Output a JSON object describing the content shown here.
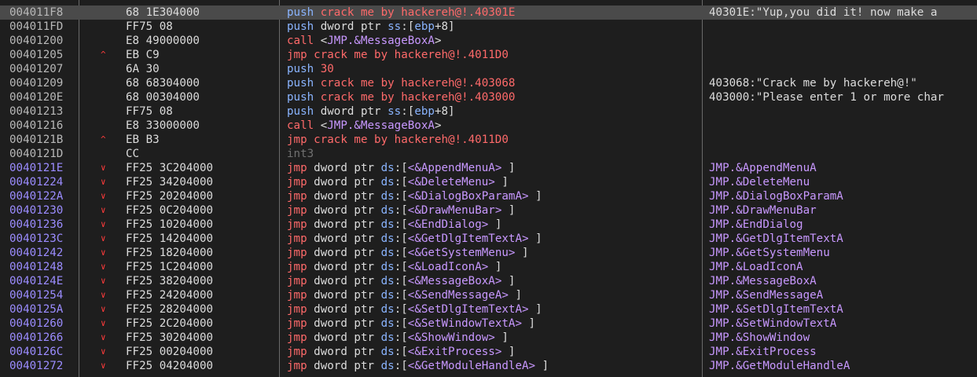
{
  "colors": {
    "background": "#1e1e1e",
    "selected_row": "#4a4a4a",
    "addr_plain": "#b8b8b8",
    "addr_highlight": "#9b8cff",
    "bytes": "#dcdcdc",
    "mnemonic_red": "#ff6a6a",
    "mnemonic_push": "#8ab4ff",
    "mnemonic_call": "#ff6a6a",
    "mnemonic_jmp": "#ff6a6a",
    "operand": "#dcdcdc",
    "register": "#8ab4ff",
    "symbol": "#c898ff",
    "int3": "#707070",
    "arrow_red": "#ff3b3b",
    "comment_str": "#dcdcdc",
    "comment_sym": "#c898ff"
  },
  "rows": [
    {
      "addr": "004011F8",
      "arrow": "",
      "bytes": "68 1E304000",
      "mn": "push",
      "ops": [
        [
          "red",
          "crack me by hackereh@!.40301E"
        ]
      ],
      "comment": [
        [
          "str",
          "40301E:\"Yup,you did it! now make a"
        ]
      ],
      "selected": true,
      "addr_style": "plain"
    },
    {
      "addr": "004011FD",
      "arrow": "",
      "bytes": "FF75 08",
      "mn": "push",
      "ops": [
        [
          "op",
          "dword ptr "
        ],
        [
          "reg",
          "ss"
        ],
        [
          "op",
          ":["
        ],
        [
          "reg",
          "ebp"
        ],
        [
          "op",
          "+8]"
        ]
      ],
      "comment": [],
      "addr_style": "plain"
    },
    {
      "addr": "00401200",
      "arrow": "",
      "bytes": "E8 49000000",
      "mn": "call",
      "ops": [
        [
          "op",
          "<"
        ],
        [
          "sym",
          "JMP.&MessageBoxA"
        ],
        [
          "op",
          ">"
        ]
      ],
      "comment": [],
      "addr_style": "plain"
    },
    {
      "addr": "00401205",
      "arrow": "^",
      "bytes": "EB C9",
      "mn": "jmp",
      "ops": [
        [
          "red",
          "crack me by hackereh@!.4011D0"
        ]
      ],
      "comment": [],
      "addr_style": "plain"
    },
    {
      "addr": "00401207",
      "arrow": "",
      "bytes": "6A 30",
      "mn": "push",
      "ops": [
        [
          "red",
          "30"
        ]
      ],
      "comment": [],
      "addr_style": "plain"
    },
    {
      "addr": "00401209",
      "arrow": "",
      "bytes": "68 68304000",
      "mn": "push",
      "ops": [
        [
          "red",
          "crack me by hackereh@!.403068"
        ]
      ],
      "comment": [
        [
          "str",
          "403068:\"Crack me by hackereh@!\""
        ]
      ],
      "addr_style": "plain"
    },
    {
      "addr": "0040120E",
      "arrow": "",
      "bytes": "68 00304000",
      "mn": "push",
      "ops": [
        [
          "red",
          "crack me by hackereh@!.403000"
        ]
      ],
      "comment": [
        [
          "str",
          "403000:\"Please enter 1 or more char"
        ]
      ],
      "addr_style": "plain"
    },
    {
      "addr": "00401213",
      "arrow": "",
      "bytes": "FF75 08",
      "mn": "push",
      "ops": [
        [
          "op",
          "dword ptr "
        ],
        [
          "reg",
          "ss"
        ],
        [
          "op",
          ":["
        ],
        [
          "reg",
          "ebp"
        ],
        [
          "op",
          "+8]"
        ]
      ],
      "comment": [],
      "addr_style": "plain"
    },
    {
      "addr": "00401216",
      "arrow": "",
      "bytes": "E8 33000000",
      "mn": "call",
      "ops": [
        [
          "op",
          "<"
        ],
        [
          "sym",
          "JMP.&MessageBoxA"
        ],
        [
          "op",
          ">"
        ]
      ],
      "comment": [],
      "addr_style": "plain"
    },
    {
      "addr": "0040121B",
      "arrow": "^",
      "bytes": "EB B3",
      "mn": "jmp",
      "ops": [
        [
          "red",
          "crack me by hackereh@!.4011D0"
        ]
      ],
      "comment": [],
      "addr_style": "plain"
    },
    {
      "addr": "0040121D",
      "arrow": "",
      "bytes": "CC",
      "mn": "int3",
      "ops": [],
      "comment": [],
      "addr_style": "plain",
      "mn_style": "int3"
    },
    {
      "addr": "0040121E",
      "arrow": "v",
      "bytes": "FF25 3C204000",
      "mn": "jmp",
      "ops": [
        [
          "op",
          "dword ptr "
        ],
        [
          "reg",
          "ds"
        ],
        [
          "op",
          ":["
        ],
        [
          "sym",
          "<&AppendMenuA>"
        ],
        [
          "op",
          " ]"
        ]
      ],
      "comment": [
        [
          "sym",
          "JMP.&AppendMenuA"
        ]
      ],
      "addr_style": "hl"
    },
    {
      "addr": "00401224",
      "arrow": "v",
      "bytes": "FF25 34204000",
      "mn": "jmp",
      "ops": [
        [
          "op",
          "dword ptr "
        ],
        [
          "reg",
          "ds"
        ],
        [
          "op",
          ":["
        ],
        [
          "sym",
          "<&DeleteMenu>"
        ],
        [
          "op",
          " ]"
        ]
      ],
      "comment": [
        [
          "sym",
          "JMP.&DeleteMenu"
        ]
      ],
      "addr_style": "hl"
    },
    {
      "addr": "0040122A",
      "arrow": "v",
      "bytes": "FF25 20204000",
      "mn": "jmp",
      "ops": [
        [
          "op",
          "dword ptr "
        ],
        [
          "reg",
          "ds"
        ],
        [
          "op",
          ":["
        ],
        [
          "sym",
          "<&DialogBoxParamA>"
        ],
        [
          "op",
          " ]"
        ]
      ],
      "comment": [
        [
          "sym",
          "JMP.&DialogBoxParamA"
        ]
      ],
      "addr_style": "hl"
    },
    {
      "addr": "00401230",
      "arrow": "v",
      "bytes": "FF25 0C204000",
      "mn": "jmp",
      "ops": [
        [
          "op",
          "dword ptr "
        ],
        [
          "reg",
          "ds"
        ],
        [
          "op",
          ":["
        ],
        [
          "sym",
          "<&DrawMenuBar>"
        ],
        [
          "op",
          " ]"
        ]
      ],
      "comment": [
        [
          "sym",
          "JMP.&DrawMenuBar"
        ]
      ],
      "addr_style": "hl"
    },
    {
      "addr": "00401236",
      "arrow": "v",
      "bytes": "FF25 10204000",
      "mn": "jmp",
      "ops": [
        [
          "op",
          "dword ptr "
        ],
        [
          "reg",
          "ds"
        ],
        [
          "op",
          ":["
        ],
        [
          "sym",
          "<&EndDialog>"
        ],
        [
          "op",
          " ]"
        ]
      ],
      "comment": [
        [
          "sym",
          "JMP.&EndDialog"
        ]
      ],
      "addr_style": "hl"
    },
    {
      "addr": "0040123C",
      "arrow": "v",
      "bytes": "FF25 14204000",
      "mn": "jmp",
      "ops": [
        [
          "op",
          "dword ptr "
        ],
        [
          "reg",
          "ds"
        ],
        [
          "op",
          ":["
        ],
        [
          "sym",
          "<&GetDlgItemTextA>"
        ],
        [
          "op",
          " ]"
        ]
      ],
      "comment": [
        [
          "sym",
          "JMP.&GetDlgItemTextA"
        ]
      ],
      "addr_style": "hl"
    },
    {
      "addr": "00401242",
      "arrow": "v",
      "bytes": "FF25 18204000",
      "mn": "jmp",
      "ops": [
        [
          "op",
          "dword ptr "
        ],
        [
          "reg",
          "ds"
        ],
        [
          "op",
          ":["
        ],
        [
          "sym",
          "<&GetSystemMenu>"
        ],
        [
          "op",
          " ]"
        ]
      ],
      "comment": [
        [
          "sym",
          "JMP.&GetSystemMenu"
        ]
      ],
      "addr_style": "hl"
    },
    {
      "addr": "00401248",
      "arrow": "v",
      "bytes": "FF25 1C204000",
      "mn": "jmp",
      "ops": [
        [
          "op",
          "dword ptr "
        ],
        [
          "reg",
          "ds"
        ],
        [
          "op",
          ":["
        ],
        [
          "sym",
          "<&LoadIconA>"
        ],
        [
          "op",
          " ]"
        ]
      ],
      "comment": [
        [
          "sym",
          "JMP.&LoadIconA"
        ]
      ],
      "addr_style": "hl"
    },
    {
      "addr": "0040124E",
      "arrow": "v",
      "bytes": "FF25 38204000",
      "mn": "jmp",
      "ops": [
        [
          "op",
          "dword ptr "
        ],
        [
          "reg",
          "ds"
        ],
        [
          "op",
          ":["
        ],
        [
          "sym",
          "<&MessageBoxA>"
        ],
        [
          "op",
          " ]"
        ]
      ],
      "comment": [
        [
          "sym",
          "JMP.&MessageBoxA"
        ]
      ],
      "addr_style": "hl"
    },
    {
      "addr": "00401254",
      "arrow": "v",
      "bytes": "FF25 24204000",
      "mn": "jmp",
      "ops": [
        [
          "op",
          "dword ptr "
        ],
        [
          "reg",
          "ds"
        ],
        [
          "op",
          ":["
        ],
        [
          "sym",
          "<&SendMessageA>"
        ],
        [
          "op",
          " ]"
        ]
      ],
      "comment": [
        [
          "sym",
          "JMP.&SendMessageA"
        ]
      ],
      "addr_style": "hl"
    },
    {
      "addr": "0040125A",
      "arrow": "v",
      "bytes": "FF25 28204000",
      "mn": "jmp",
      "ops": [
        [
          "op",
          "dword ptr "
        ],
        [
          "reg",
          "ds"
        ],
        [
          "op",
          ":["
        ],
        [
          "sym",
          "<&SetDlgItemTextA>"
        ],
        [
          "op",
          " ]"
        ]
      ],
      "comment": [
        [
          "sym",
          "JMP.&SetDlgItemTextA"
        ]
      ],
      "addr_style": "hl"
    },
    {
      "addr": "00401260",
      "arrow": "v",
      "bytes": "FF25 2C204000",
      "mn": "jmp",
      "ops": [
        [
          "op",
          "dword ptr "
        ],
        [
          "reg",
          "ds"
        ],
        [
          "op",
          ":["
        ],
        [
          "sym",
          "<&SetWindowTextA>"
        ],
        [
          "op",
          " ]"
        ]
      ],
      "comment": [
        [
          "sym",
          "JMP.&SetWindowTextA"
        ]
      ],
      "addr_style": "hl"
    },
    {
      "addr": "00401266",
      "arrow": "v",
      "bytes": "FF25 30204000",
      "mn": "jmp",
      "ops": [
        [
          "op",
          "dword ptr "
        ],
        [
          "reg",
          "ds"
        ],
        [
          "op",
          ":["
        ],
        [
          "sym",
          "<&ShowWindow>"
        ],
        [
          "op",
          " ]"
        ]
      ],
      "comment": [
        [
          "sym",
          "JMP.&ShowWindow"
        ]
      ],
      "addr_style": "hl"
    },
    {
      "addr": "0040126C",
      "arrow": "v",
      "bytes": "FF25 00204000",
      "mn": "jmp",
      "ops": [
        [
          "op",
          "dword ptr "
        ],
        [
          "reg",
          "ds"
        ],
        [
          "op",
          ":["
        ],
        [
          "sym",
          "<&ExitProcess>"
        ],
        [
          "op",
          " ]"
        ]
      ],
      "comment": [
        [
          "sym",
          "JMP.&ExitProcess"
        ]
      ],
      "addr_style": "hl"
    },
    {
      "addr": "00401272",
      "arrow": "v",
      "bytes": "FF25 04204000",
      "mn": "jmp",
      "ops": [
        [
          "op",
          "dword ptr "
        ],
        [
          "reg",
          "ds"
        ],
        [
          "op",
          ":["
        ],
        [
          "sym",
          "<&GetModuleHandleA>"
        ],
        [
          "op",
          " ]"
        ]
      ],
      "comment": [
        [
          "sym",
          "JMP.&GetModuleHandleA"
        ]
      ],
      "addr_style": "hl"
    }
  ]
}
